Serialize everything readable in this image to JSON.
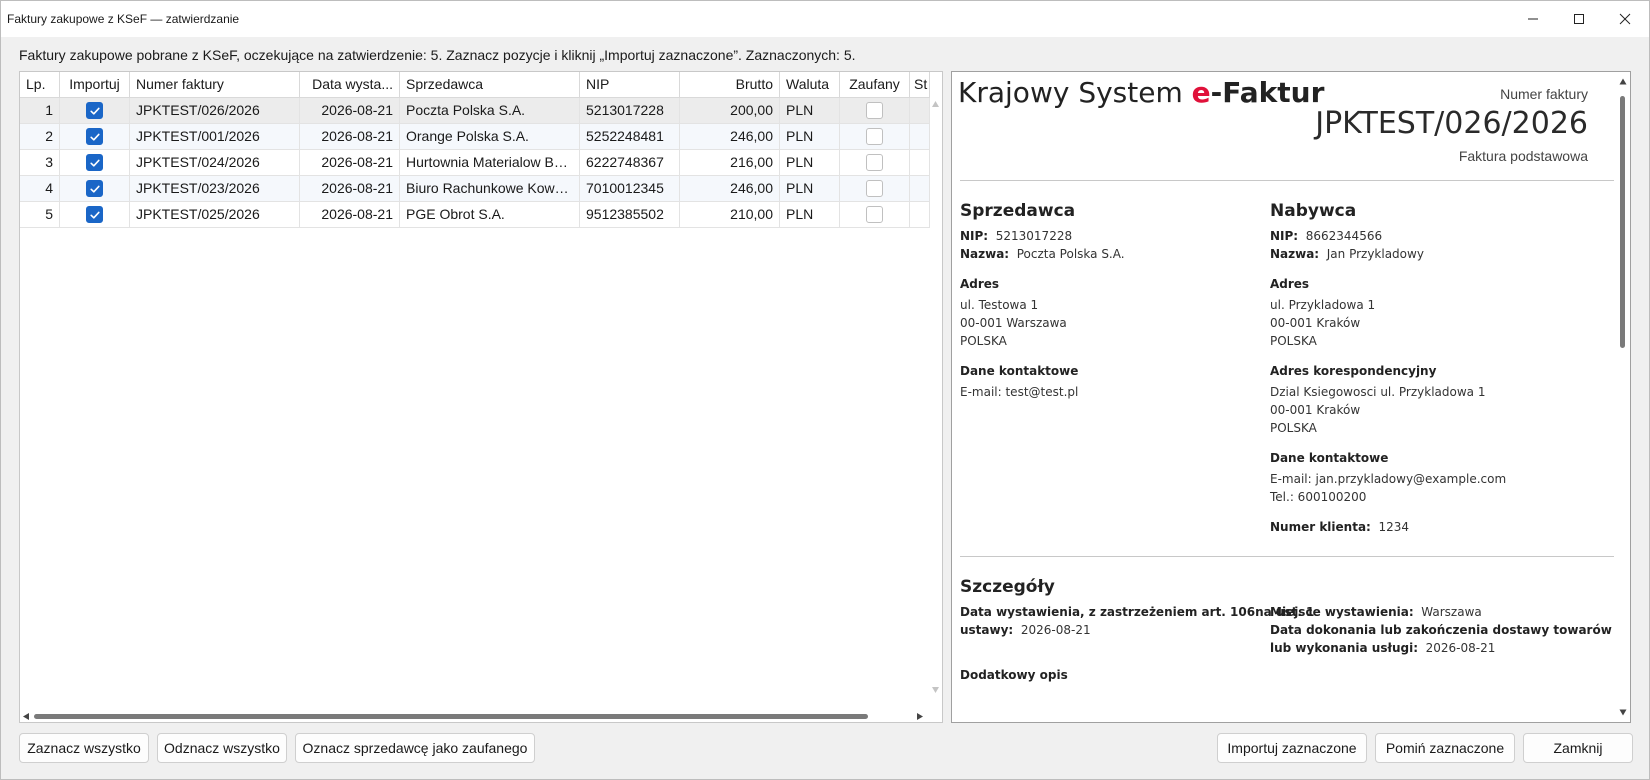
{
  "window": {
    "title": "Faktury zakupowe z KSeF — zatwierdzanie"
  },
  "instruction": "Faktury zakupowe pobrane z KSeF, oczekujące na zatwierdzenie: 5. Zaznacz pozycje i kliknij „Importuj zaznaczone”. Zaznaczonych: 5.",
  "table": {
    "columns": [
      "Lp.",
      "Importuj",
      "Numer faktury",
      "Data wysta...",
      "Sprzedawca",
      "NIP",
      "Brutto",
      "Waluta",
      "Zaufany",
      "St"
    ],
    "rows": [
      {
        "lp": "1",
        "importuj": true,
        "numer": "JPKTEST/026/2026",
        "data": "2026-08-21",
        "sprzedawca": "Poczta Polska S.A.",
        "nip": "5213017228",
        "brutto": "200,00",
        "waluta": "PLN",
        "zaufany": false
      },
      {
        "lp": "2",
        "importuj": true,
        "numer": "JPKTEST/001/2026",
        "data": "2026-08-21",
        "sprzedawca": "Orange Polska S.A.",
        "nip": "5252248481",
        "brutto": "246,00",
        "waluta": "PLN",
        "zaufany": false
      },
      {
        "lp": "3",
        "importuj": true,
        "numer": "JPKTEST/024/2026",
        "data": "2026-08-21",
        "sprzedawca": "Hurtownia Materialow Bu...",
        "nip": "6222748367",
        "brutto": "216,00",
        "waluta": "PLN",
        "zaufany": false
      },
      {
        "lp": "4",
        "importuj": true,
        "numer": "JPKTEST/023/2026",
        "data": "2026-08-21",
        "sprzedawca": "Biuro Rachunkowe Kowal...",
        "nip": "7010012345",
        "brutto": "246,00",
        "waluta": "PLN",
        "zaufany": false
      },
      {
        "lp": "5",
        "importuj": true,
        "numer": "JPKTEST/025/2026",
        "data": "2026-08-21",
        "sprzedawca": "PGE Obrot S.A.",
        "nip": "9512385502",
        "brutto": "210,00",
        "waluta": "PLN",
        "zaufany": false
      }
    ]
  },
  "preview": {
    "brand_prefix": "Krajowy System ",
    "brand_e": "e",
    "brand_suffix": "-Faktur",
    "numer_label": "Numer faktury",
    "numer": "JPKTEST/026/2026",
    "kind": "Faktura podstawowa",
    "seller": {
      "heading": "Sprzedawca",
      "nip_label": "NIP:",
      "nip": "5213017228",
      "nazwa_label": "Nazwa:",
      "nazwa": "Poczta Polska S.A.",
      "adres_heading": "Adres",
      "adres_lines": [
        "ul. Testowa 1",
        "00-001 Warszawa",
        "POLSKA"
      ],
      "kontakt_heading": "Dane kontaktowe",
      "kontakt_lines": [
        "E-mail: test@test.pl"
      ]
    },
    "buyer": {
      "heading": "Nabywca",
      "nip_label": "NIP:",
      "nip": "8662344566",
      "nazwa_label": "Nazwa:",
      "nazwa": "Jan Przykladowy",
      "adres_heading": "Adres",
      "adres_lines": [
        "ul. Przykladowa 1",
        "00-001 Kraków",
        "POLSKA"
      ],
      "koresp_heading": "Adres korespondencyjny",
      "koresp_lines": [
        "Dzial Ksiegowosci ul. Przykladowa 1",
        "00-001 Kraków",
        "POLSKA"
      ],
      "kontakt_heading": "Dane kontaktowe",
      "kontakt_lines": [
        "E-mail: jan.przykladowy@example.com",
        "Tel.: 600100200"
      ],
      "klient_label": "Numer klienta:",
      "klient": "1234"
    },
    "details": {
      "heading": "Szczegóły",
      "data_label_1": "Data wystawienia, z zastrzeżeniem art. 106na ust. 1",
      "data_label_2": "ustawy:",
      "data_value": "2026-08-21",
      "miejsce_label": "Miejsce wystawienia:",
      "miejsce_value": "Warszawa",
      "dostawa_label_1": "Data dokonania lub zakończenia dostawy towarów",
      "dostawa_label_2": "lub wykonania usługi:",
      "dostawa_value": "2026-08-21",
      "opis_heading": "Dodatkowy opis"
    }
  },
  "buttons": {
    "select_all": "Zaznacz wszystko",
    "deselect_all": "Odznacz wszystko",
    "mark_trusted": "Oznacz sprzedawcę jako zaufanego",
    "import_selected": "Importuj zaznaczone",
    "skip_selected": "Pomiń zaznaczone",
    "close": "Zamknij"
  },
  "colors": {
    "checkbox_checked": "#1a66c7",
    "brand_e": "#e0113a"
  }
}
